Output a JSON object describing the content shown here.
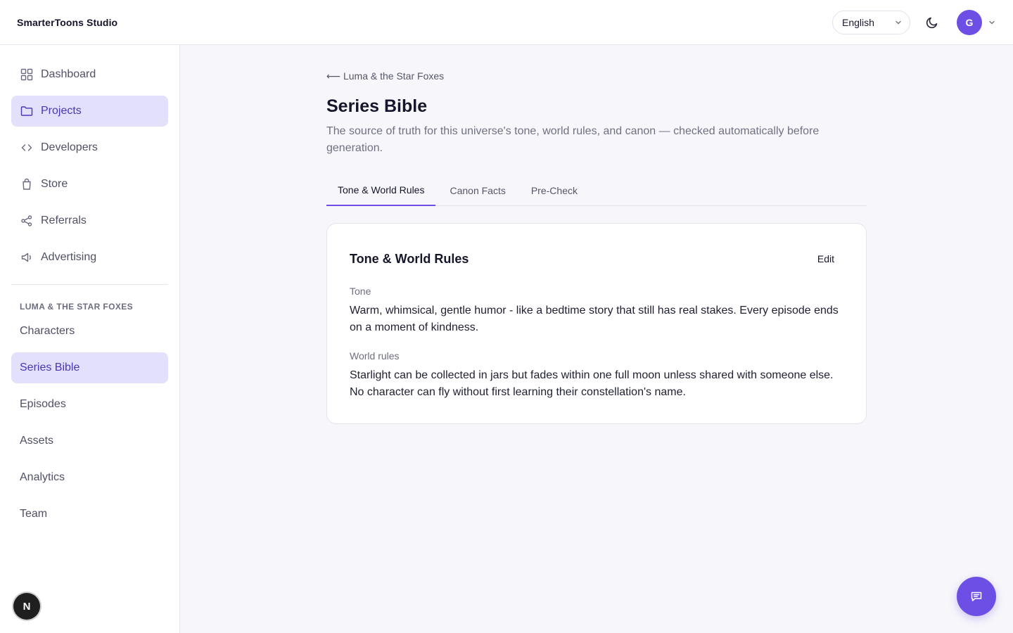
{
  "app": {
    "brand": "SmarterToons Studio"
  },
  "header": {
    "language": "English",
    "avatar_initial": "G"
  },
  "sidebar": {
    "items": [
      {
        "label": "Dashboard",
        "icon": "grid-icon"
      },
      {
        "label": "Projects",
        "icon": "folder-icon",
        "active": true
      },
      {
        "label": "Developers",
        "icon": "code-icon"
      },
      {
        "label": "Store",
        "icon": "bag-icon"
      },
      {
        "label": "Referrals",
        "icon": "share-icon"
      },
      {
        "label": "Advertising",
        "icon": "megaphone-icon"
      }
    ],
    "section_label": "LUMA & THE STAR FOXES",
    "sub_items": [
      {
        "label": "Characters"
      },
      {
        "label": "Series Bible",
        "active": true
      },
      {
        "label": "Episodes"
      },
      {
        "label": "Assets"
      },
      {
        "label": "Analytics"
      },
      {
        "label": "Team"
      }
    ],
    "badge": "N"
  },
  "main": {
    "back_link": "⟵ Luma & the Star Foxes",
    "title": "Series Bible",
    "description": "The source of truth for this universe's tone, world rules, and canon — checked automatically before generation.",
    "tabs": [
      {
        "label": "Tone & World Rules",
        "active": true
      },
      {
        "label": "Canon Facts"
      },
      {
        "label": "Pre-Check"
      }
    ],
    "card": {
      "title": "Tone & World Rules",
      "edit_label": "Edit",
      "tone_label": "Tone",
      "tone_value": "Warm, whimsical, gentle humor - like a bedtime story that still has real stakes. Every episode ends on a moment of kindness.",
      "world_label": "World rules",
      "world_value": "Starlight can be collected in jars but fades within one full moon unless shared with someone else. No character can fly without first learning their constellation's name."
    }
  },
  "colors": {
    "accent": "#6d4fe6",
    "active_bg": "#e2e0fb",
    "active_text": "#4c36b8"
  }
}
